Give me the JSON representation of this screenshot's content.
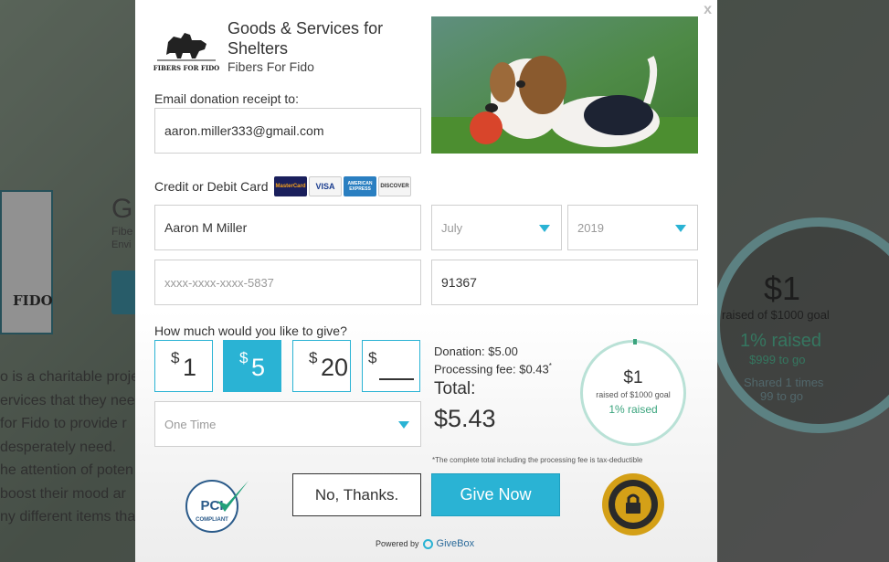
{
  "background": {
    "title_partial": "G",
    "sub1_partial": "Fibe",
    "sub2_partial": "Envi",
    "logo_text_partial": "FIDO",
    "paragraph_lines": [
      "o is a charitable proje",
      "ervices that they nee",
      " for Fido to provide r",
      " desperately need.",
      "he attention of poten",
      " boost their mood ar",
      "ny different items tha"
    ],
    "ring": {
      "amount": "$1",
      "goal": "raised of $1000 goal",
      "percent": "1% raised",
      "to_go": "$999 to go",
      "shared": "Shared 1 times",
      "days": "99 to go"
    }
  },
  "modal": {
    "close": "x",
    "org": {
      "title": "Goods & Services for Shelters",
      "name": "Fibers For Fido",
      "logo_text": "FIBERS FOR FIDO"
    },
    "email": {
      "label": "Email donation receipt to:",
      "value": "aaron.miller333@gmail.com"
    },
    "card": {
      "label": "Credit or Debit Card",
      "brands": [
        "MasterCard",
        "VISA",
        "AMERICAN EXPRESS",
        "DISCOVER"
      ],
      "name_value": "Aaron M Miller",
      "month_value": "July",
      "year_value": "2019",
      "number_value": "xxxx-xxxx-xxxx-5837",
      "zip_value": "91367"
    },
    "give": {
      "label": "How much would you like to give?",
      "currency": "$",
      "amounts": [
        "1",
        "5",
        "20"
      ],
      "selected_index": 1,
      "frequency": "One Time"
    },
    "summary": {
      "donation": "Donation: $5.00",
      "fee": "Processing fee: $0.43",
      "fee_mark": "*",
      "total_label": "Total:",
      "total_value": "$5.43",
      "note": "*The complete total including the processing fee is tax-deductible"
    },
    "progress": {
      "amount": "$1",
      "goal": "raised of $1000 goal",
      "percent": "1% raised",
      "fraction": 0.01
    },
    "buttons": {
      "no": "No, Thanks.",
      "give": "Give Now"
    },
    "badges": {
      "pci_line1": "PCI",
      "pci_line2": "COMPLIANT",
      "secure_text": "100% SECURE"
    },
    "footer": {
      "powered": "Powered by",
      "brand": "GiveBox"
    },
    "colors": {
      "accent": "#2ab3d4",
      "ring_green": "#3aa47d"
    }
  }
}
